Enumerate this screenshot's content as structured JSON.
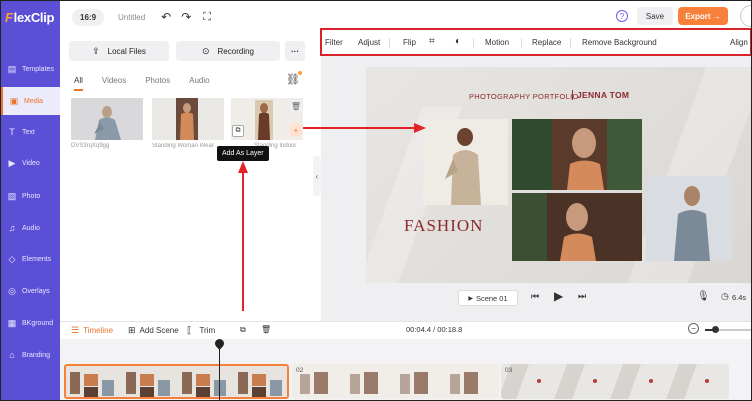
{
  "app": {
    "logo_rest": "lexClip",
    "logo_f": "F"
  },
  "sidebar": {
    "items": [
      {
        "label": "Templates",
        "icon": "templates-icon",
        "glyph": "▤"
      },
      {
        "label": "Media",
        "icon": "media-icon",
        "glyph": "▣"
      },
      {
        "label": "Text",
        "icon": "text-icon",
        "glyph": "T"
      },
      {
        "label": "Video",
        "icon": "video-icon",
        "glyph": "▶"
      },
      {
        "label": "Photo",
        "icon": "photo-icon",
        "glyph": "▨"
      },
      {
        "label": "Audio",
        "icon": "audio-icon",
        "glyph": "♫"
      },
      {
        "label": "Elements",
        "icon": "elements-icon",
        "glyph": "◇"
      },
      {
        "label": "Overlays",
        "icon": "overlays-icon",
        "glyph": "◎"
      },
      {
        "label": "BKground",
        "icon": "background-icon",
        "glyph": "▦"
      },
      {
        "label": "Branding",
        "icon": "branding-icon",
        "glyph": "⌂"
      }
    ]
  },
  "topbar": {
    "ratio": "16:9",
    "title": "Untitled",
    "save": "Save",
    "export": "Export →"
  },
  "media": {
    "local_files": "Local Files",
    "recording": "Recording",
    "more": "···",
    "tabs": [
      "All",
      "Videos",
      "Photos",
      "Audio"
    ],
    "items": [
      {
        "caption": "DVS3rqXq9gg"
      },
      {
        "caption": "Standing Woman Wear"
      },
      {
        "caption": "Standing Indoor"
      }
    ],
    "tooltip": "Add As Layer"
  },
  "toolbar": {
    "filter": "Filter",
    "adjust": "Adjust",
    "flip": "Flip",
    "motion": "Motion",
    "replace": "Replace",
    "remove_bg": "Remove Background",
    "align": "Align"
  },
  "canvas": {
    "portfolio": "PHOTOGRAPHY PORTFOLIO",
    "name": "JENNA TOM",
    "fashion": "FASHION"
  },
  "player": {
    "scene": "Scene 01",
    "duration": "6.4s"
  },
  "timeline": {
    "timeline_label": "Timeline",
    "add_scene": "Add Scene",
    "trim": "Trim",
    "timecode": "00:04.4 / 00:18.8",
    "clip_numbers": [
      "02",
      "03"
    ]
  },
  "colors": {
    "sidebar": "#5b4fd6",
    "accent": "#f7803a",
    "annotation_red": "#e2232a",
    "title_red": "#8b2a2e"
  }
}
